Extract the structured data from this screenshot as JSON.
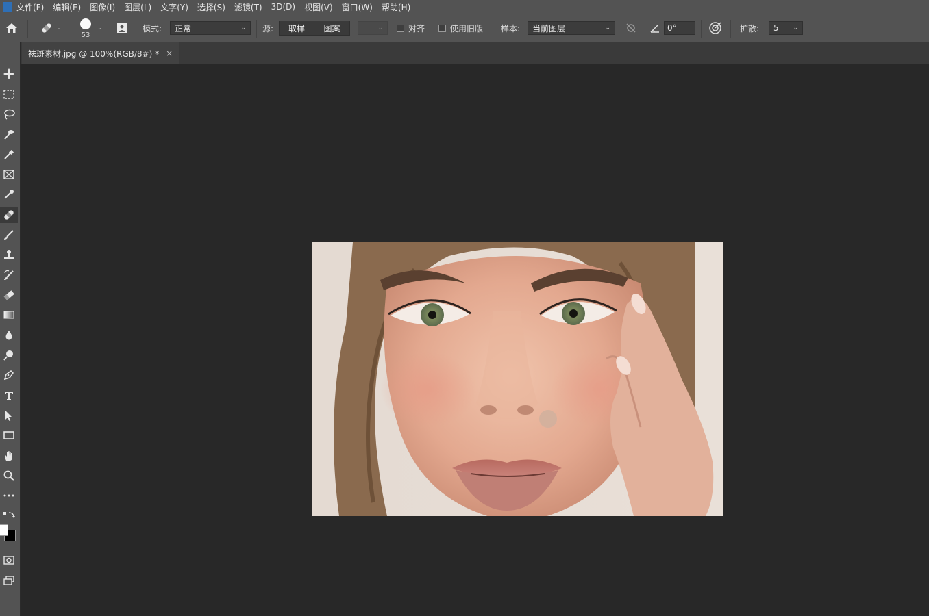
{
  "menu": [
    "文件(F)",
    "编辑(E)",
    "图像(I)",
    "图层(L)",
    "文字(Y)",
    "选择(S)",
    "滤镜(T)",
    "3D(D)",
    "视图(V)",
    "窗口(W)",
    "帮助(H)"
  ],
  "options": {
    "brush_size": "53",
    "mode_label": "模式:",
    "mode_value": "正常",
    "source_label": "源:",
    "source_sampled": "取样",
    "source_pattern": "图案",
    "align_label": "对齐",
    "legacy_label": "使用旧版",
    "sample_label": "样本:",
    "sample_value": "当前图层",
    "angle_value": "0°",
    "diffusion_label": "扩散:",
    "diffusion_value": "5"
  },
  "document": {
    "tab_title": "祛斑素材.jpg @ 100%(RGB/8#) *",
    "close_glyph": "×"
  },
  "tools": [
    "move-tool",
    "marquee-tool",
    "lasso-tool",
    "quick-select-tool",
    "eyedropper-tool",
    "frame-tool",
    "brush-sample-tool",
    "healing-brush-tool",
    "brush-tool",
    "clone-stamp-tool",
    "history-brush-tool",
    "eraser-tool",
    "gradient-tool",
    "blur-tool",
    "dodge-tool",
    "pen-tool",
    "type-tool",
    "path-select-tool",
    "rectangle-tool",
    "hand-tool",
    "zoom-tool",
    "more-tools"
  ],
  "colors": {
    "ui_panel": "#535353",
    "canvas_bg": "#282828",
    "foreground": "#ffffff",
    "background": "#000000"
  }
}
